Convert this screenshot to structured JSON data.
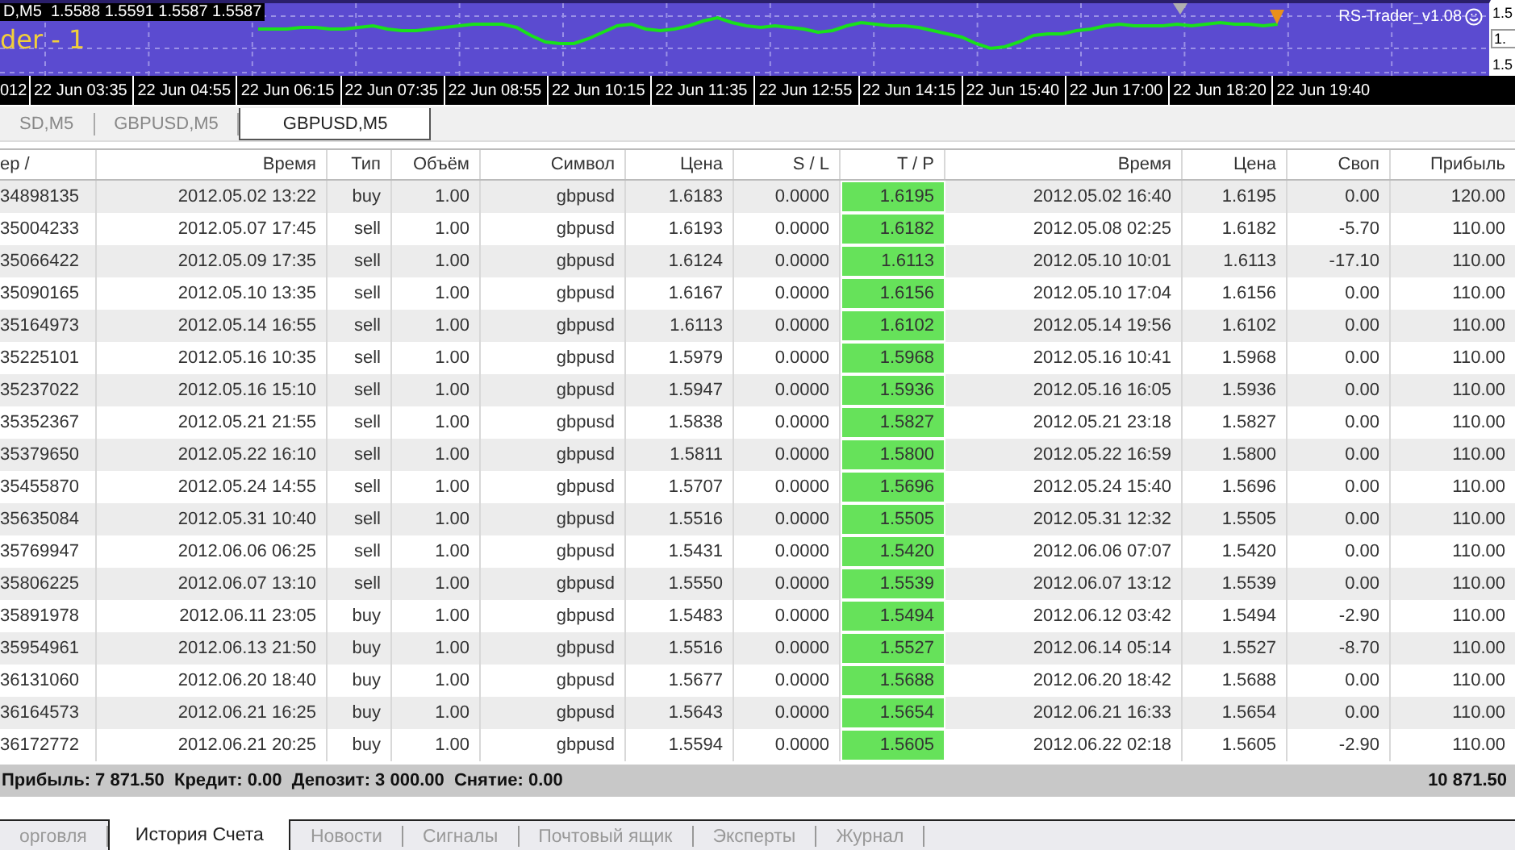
{
  "chart": {
    "legend": "D,M5  1.5588 1.5591 1.5587 1.5587",
    "indicator_label": "der - 1",
    "expert_label": "RS-Trader_v1.08",
    "price_axis": [
      "1.5",
      "1.",
      "1.5"
    ],
    "time_axis": [
      "012",
      "22 Jun 03:35",
      "22 Jun 04:55",
      "22 Jun 06:15",
      "22 Jun 07:35",
      "22 Jun 08:55",
      "22 Jun 10:15",
      "22 Jun 11:35",
      "22 Jun 12:55",
      "22 Jun 14:15",
      "22 Jun 15:40",
      "22 Jun 17:00",
      "22 Jun 18:20",
      "22 Jun 19:40"
    ]
  },
  "chart_tabs": [
    {
      "label": "SD,M5",
      "selected": false
    },
    {
      "label": "GBPUSD,M5",
      "selected": false
    },
    {
      "label": "GBPUSD,M5",
      "selected": true
    }
  ],
  "table": {
    "columns": [
      "ер  /",
      "Время",
      "Тип",
      "Объём",
      "Символ",
      "Цена",
      "S / L",
      "T / P",
      "Время",
      "Цена",
      "Своп",
      "Прибыль"
    ],
    "rows": [
      {
        "cells": [
          "34898135",
          "2012.05.02 13:22",
          "buy",
          "1.00",
          "gbpusd",
          "1.6183",
          "0.0000",
          "1.6195",
          "2012.05.02 16:40",
          "1.6195",
          "0.00",
          "120.00"
        ],
        "tp_hit": true
      },
      {
        "cells": [
          "35004233",
          "2012.05.07 17:45",
          "sell",
          "1.00",
          "gbpusd",
          "1.6193",
          "0.0000",
          "1.6182",
          "2012.05.08 02:25",
          "1.6182",
          "-5.70",
          "110.00"
        ],
        "tp_hit": true
      },
      {
        "cells": [
          "35066422",
          "2012.05.09 17:35",
          "sell",
          "1.00",
          "gbpusd",
          "1.6124",
          "0.0000",
          "1.6113",
          "2012.05.10 10:01",
          "1.6113",
          "-17.10",
          "110.00"
        ],
        "tp_hit": true
      },
      {
        "cells": [
          "35090165",
          "2012.05.10 13:35",
          "sell",
          "1.00",
          "gbpusd",
          "1.6167",
          "0.0000",
          "1.6156",
          "2012.05.10 17:04",
          "1.6156",
          "0.00",
          "110.00"
        ],
        "tp_hit": true
      },
      {
        "cells": [
          "35164973",
          "2012.05.14 16:55",
          "sell",
          "1.00",
          "gbpusd",
          "1.6113",
          "0.0000",
          "1.6102",
          "2012.05.14 19:56",
          "1.6102",
          "0.00",
          "110.00"
        ],
        "tp_hit": true
      },
      {
        "cells": [
          "35225101",
          "2012.05.16 10:35",
          "sell",
          "1.00",
          "gbpusd",
          "1.5979",
          "0.0000",
          "1.5968",
          "2012.05.16 10:41",
          "1.5968",
          "0.00",
          "110.00"
        ],
        "tp_hit": true
      },
      {
        "cells": [
          "35237022",
          "2012.05.16 15:10",
          "sell",
          "1.00",
          "gbpusd",
          "1.5947",
          "0.0000",
          "1.5936",
          "2012.05.16 16:05",
          "1.5936",
          "0.00",
          "110.00"
        ],
        "tp_hit": true
      },
      {
        "cells": [
          "35352367",
          "2012.05.21 21:55",
          "sell",
          "1.00",
          "gbpusd",
          "1.5838",
          "0.0000",
          "1.5827",
          "2012.05.21 23:18",
          "1.5827",
          "0.00",
          "110.00"
        ],
        "tp_hit": true
      },
      {
        "cells": [
          "35379650",
          "2012.05.22 16:10",
          "sell",
          "1.00",
          "gbpusd",
          "1.5811",
          "0.0000",
          "1.5800",
          "2012.05.22 16:59",
          "1.5800",
          "0.00",
          "110.00"
        ],
        "tp_hit": true
      },
      {
        "cells": [
          "35455870",
          "2012.05.24 14:55",
          "sell",
          "1.00",
          "gbpusd",
          "1.5707",
          "0.0000",
          "1.5696",
          "2012.05.24 15:40",
          "1.5696",
          "0.00",
          "110.00"
        ],
        "tp_hit": true
      },
      {
        "cells": [
          "35635084",
          "2012.05.31 10:40",
          "sell",
          "1.00",
          "gbpusd",
          "1.5516",
          "0.0000",
          "1.5505",
          "2012.05.31 12:32",
          "1.5505",
          "0.00",
          "110.00"
        ],
        "tp_hit": true
      },
      {
        "cells": [
          "35769947",
          "2012.06.06 06:25",
          "sell",
          "1.00",
          "gbpusd",
          "1.5431",
          "0.0000",
          "1.5420",
          "2012.06.06 07:07",
          "1.5420",
          "0.00",
          "110.00"
        ],
        "tp_hit": true
      },
      {
        "cells": [
          "35806225",
          "2012.06.07 13:10",
          "sell",
          "1.00",
          "gbpusd",
          "1.5550",
          "0.0000",
          "1.5539",
          "2012.06.07 13:12",
          "1.5539",
          "0.00",
          "110.00"
        ],
        "tp_hit": true
      },
      {
        "cells": [
          "35891978",
          "2012.06.11 23:05",
          "buy",
          "1.00",
          "gbpusd",
          "1.5483",
          "0.0000",
          "1.5494",
          "2012.06.12 03:42",
          "1.5494",
          "-2.90",
          "110.00"
        ],
        "tp_hit": true
      },
      {
        "cells": [
          "35954961",
          "2012.06.13 21:50",
          "buy",
          "1.00",
          "gbpusd",
          "1.5516",
          "0.0000",
          "1.5527",
          "2012.06.14 05:14",
          "1.5527",
          "-8.70",
          "110.00"
        ],
        "tp_hit": true
      },
      {
        "cells": [
          "36131060",
          "2012.06.20 18:40",
          "buy",
          "1.00",
          "gbpusd",
          "1.5677",
          "0.0000",
          "1.5688",
          "2012.06.20 18:42",
          "1.5688",
          "0.00",
          "110.00"
        ],
        "tp_hit": true
      },
      {
        "cells": [
          "36164573",
          "2012.06.21 16:25",
          "buy",
          "1.00",
          "gbpusd",
          "1.5643",
          "0.0000",
          "1.5654",
          "2012.06.21 16:33",
          "1.5654",
          "0.00",
          "110.00"
        ],
        "tp_hit": true
      },
      {
        "cells": [
          "36172772",
          "2012.06.21 20:25",
          "buy",
          "1.00",
          "gbpusd",
          "1.5594",
          "0.0000",
          "1.5605",
          "2012.06.22 02:18",
          "1.5605",
          "-2.90",
          "110.00"
        ],
        "tp_hit": true
      }
    ]
  },
  "summary": {
    "text": "Прибыль: 7 871.50  Кредит: 0.00  Депозит: 3 000.00  Снятие: 0.00",
    "total": "10 871.50"
  },
  "bottom_tabs": [
    {
      "label": "орговля",
      "selected": false
    },
    {
      "label": "История Счета",
      "selected": true
    },
    {
      "label": "Новости",
      "selected": false
    },
    {
      "label": "Сигналы",
      "selected": false
    },
    {
      "label": "Почтовый ящик",
      "selected": false
    },
    {
      "label": "Эксперты",
      "selected": false
    },
    {
      "label": "Журнал",
      "selected": false
    }
  ]
}
